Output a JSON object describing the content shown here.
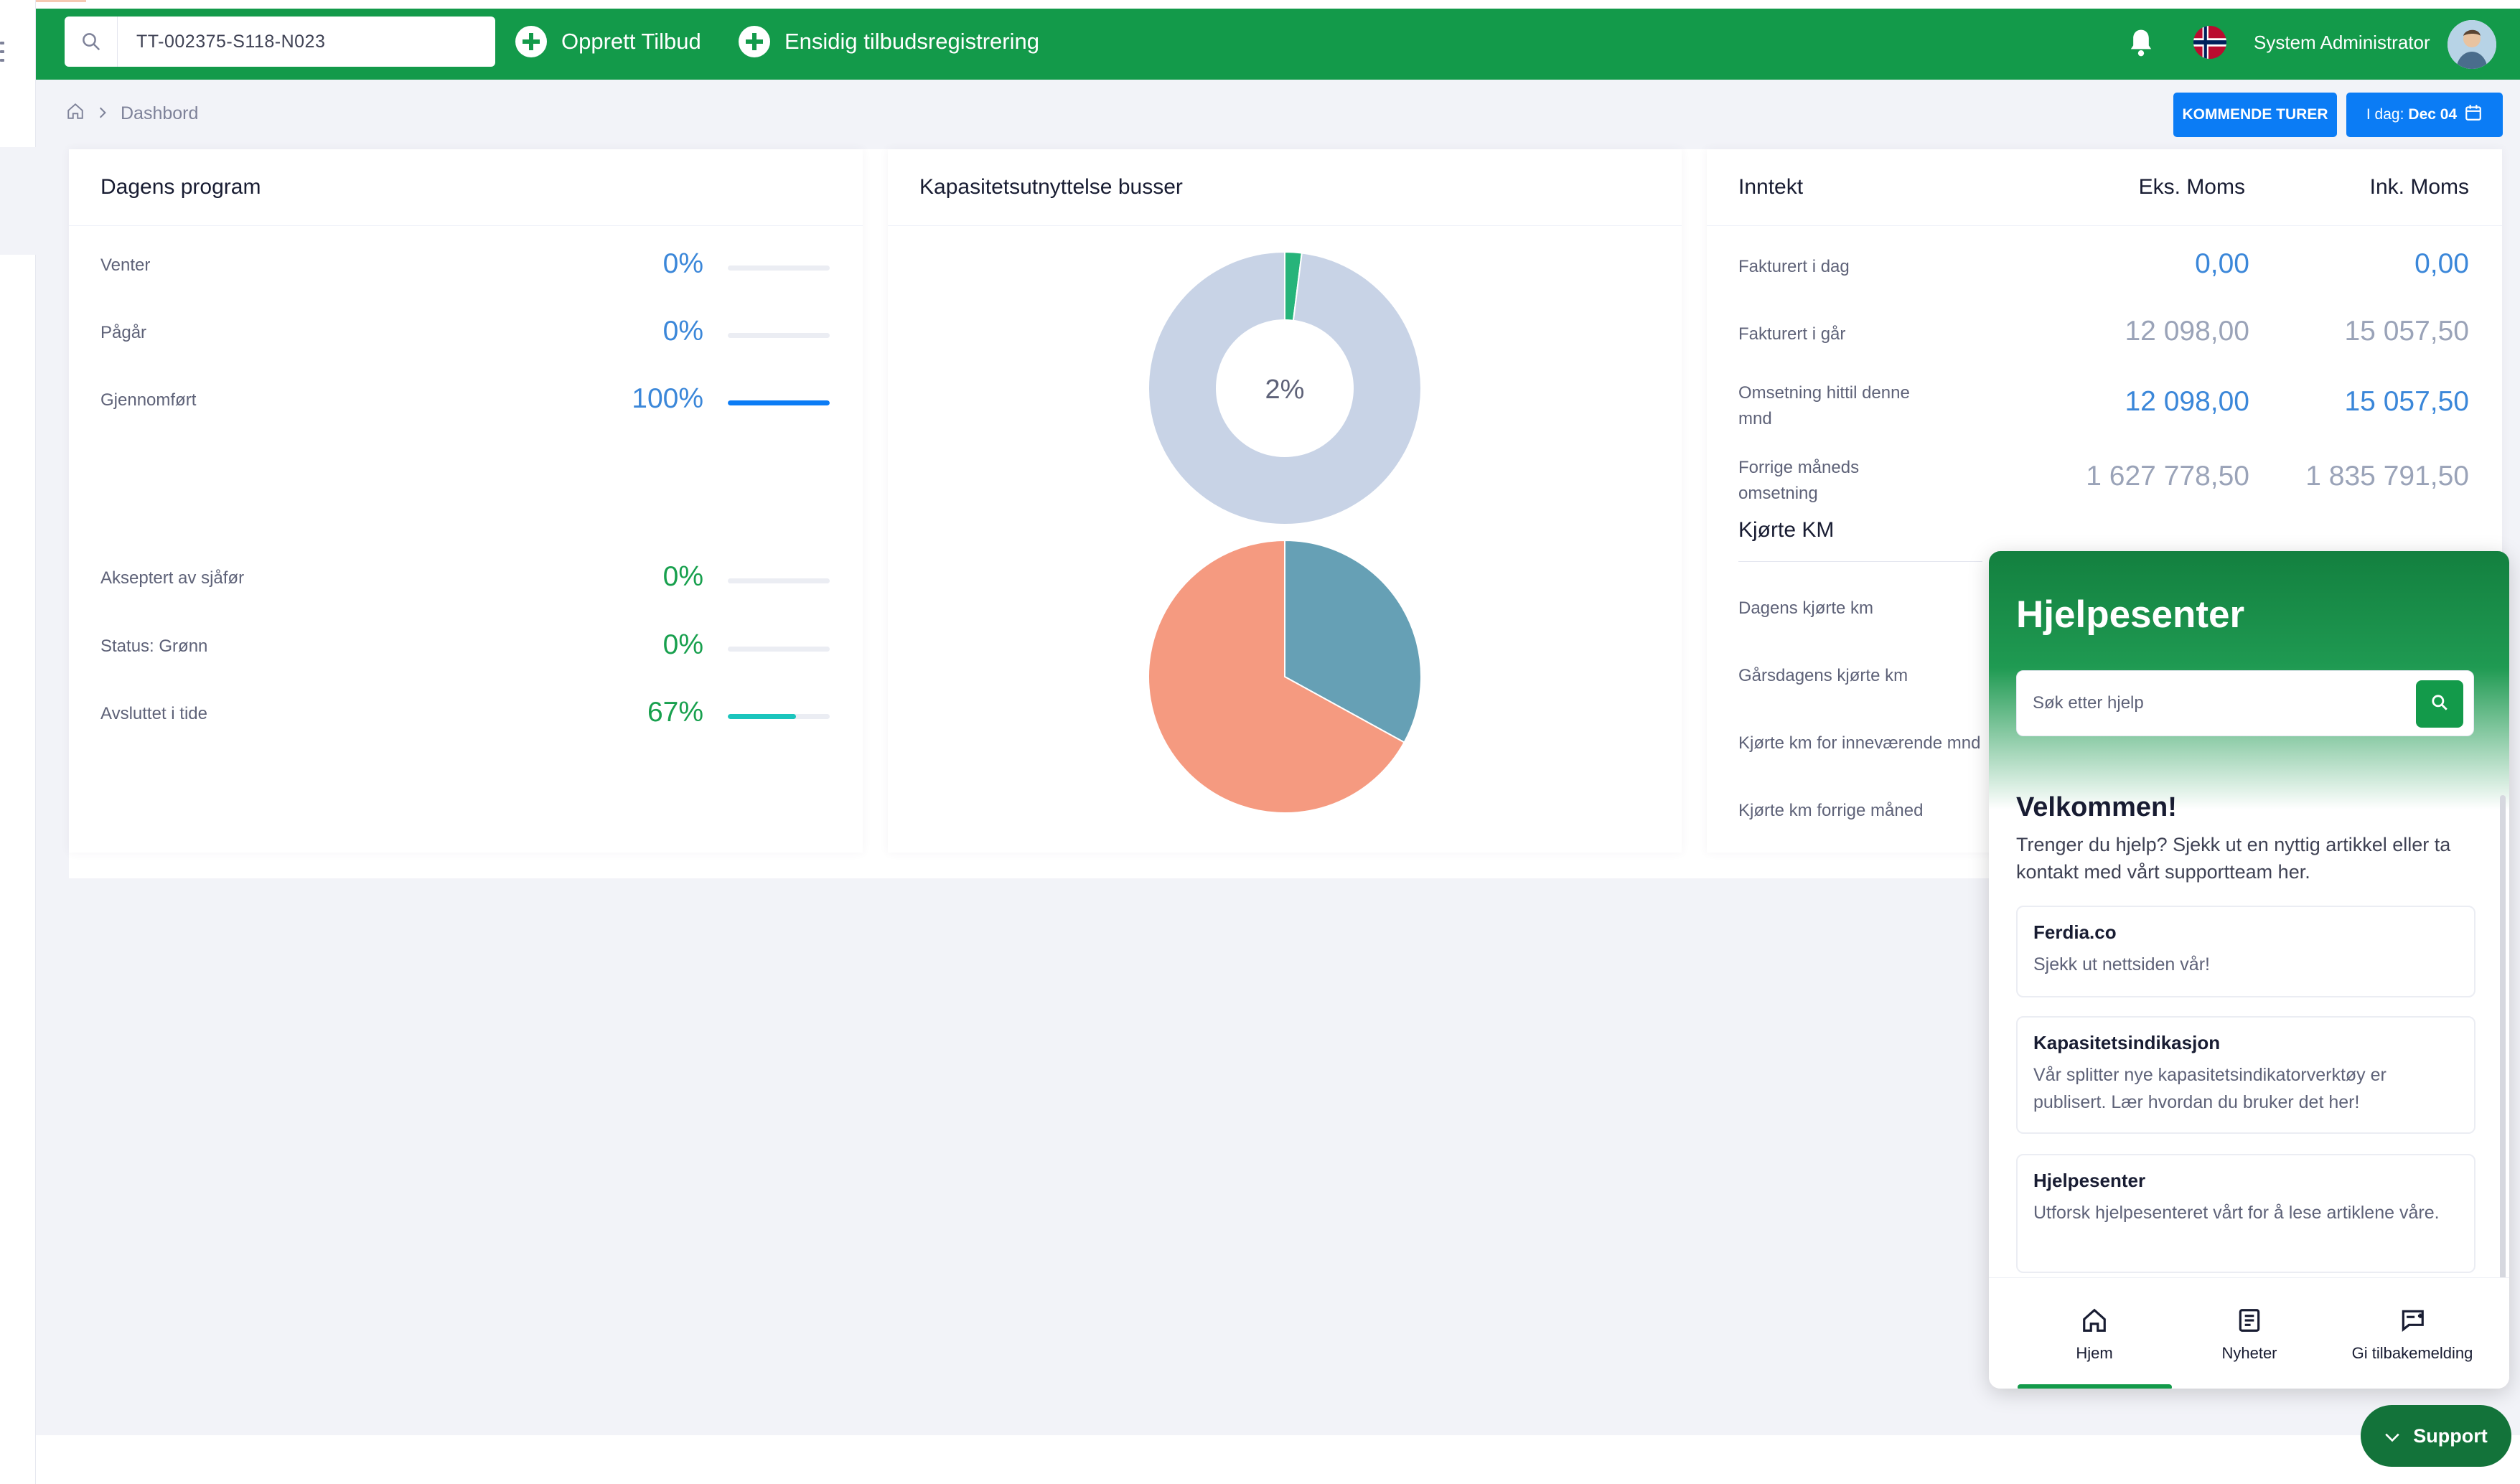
{
  "header": {
    "search_value": "TT-002375-S118-N023",
    "create_offer_label": "Opprett Tilbud",
    "one_way_label": "Ensidig tilbudsregistrering",
    "user_name": "System Administrator",
    "brand_color": "#139a4a"
  },
  "breadcrumb": {
    "home_icon": "home-icon",
    "current": "Dashbord"
  },
  "actions": {
    "upcoming_label": "KOMMENDE TURER",
    "today_prefix": "I dag:",
    "today_date": "Dec 04"
  },
  "program": {
    "title": "Dagens program",
    "rows": [
      {
        "label": "Venter",
        "pct": "0%",
        "fill": 0
      },
      {
        "label": "Pågår",
        "pct": "0%",
        "fill": 0
      },
      {
        "label": "Gjennomført",
        "pct": "100%",
        "fill": 1
      }
    ],
    "rows2": [
      {
        "label": "Akseptert av sjåfør",
        "pct": "0%",
        "fill": 0
      },
      {
        "label": "Status: Grønn",
        "pct": "0%",
        "fill": 0
      },
      {
        "label": "Avsluttet i tide",
        "pct": "67%",
        "fill": 0.67
      }
    ]
  },
  "capacity": {
    "title": "Kapasitetsutnyttelse busser"
  },
  "chart_data": [
    {
      "type": "pie",
      "donut": true,
      "center_label": "2%",
      "values": [
        2,
        98
      ],
      "colors": [
        "#26b47a",
        "#c8d3e6"
      ]
    },
    {
      "type": "pie",
      "values": [
        33,
        67
      ],
      "colors": [
        "#66a0b5",
        "#f59a80"
      ]
    }
  ],
  "income": {
    "title": "Inntekt",
    "col1": "Eks. Moms",
    "col2": "Ink. Moms",
    "rows": [
      {
        "label": "Fakturert i dag",
        "ex": "0,00",
        "inc": "0,00"
      },
      {
        "label": "Fakturert i går",
        "ex": "12 098,00",
        "inc": "15 057,50"
      },
      {
        "label": "Omsetning hittil denne mnd",
        "ex": "12 098,00",
        "inc": "15 057,50"
      },
      {
        "label": "Forrige måneds omsetning",
        "ex": "1 627 778,50",
        "inc": "1 835 791,50"
      }
    ],
    "km_title": "Kjørte KM",
    "km_rows": [
      "Dagens kjørte km",
      "Gårsdagens kjørte km",
      "Kjørte km for inneværende mnd",
      "Kjørte km forrige måned"
    ]
  },
  "help": {
    "title": "Hjelpesenter",
    "search_placeholder": "Søk etter hjelp",
    "welcome": "Velkommen!",
    "welcome_text": "Trenger du hjelp? Sjekk ut en nyttig artikkel eller ta kontakt med vårt supportteam her.",
    "cards": [
      {
        "title": "Ferdia.co",
        "desc": "Sjekk ut nettsiden vår!"
      },
      {
        "title": "Kapasitetsindikasjon",
        "desc": "Vår splitter nye kapasitetsindikatorverktøy er publisert. Lær hvordan du bruker det her!"
      },
      {
        "title": "Hjelpesenter",
        "desc": "Utforsk hjelpesenteret vårt for å lese artiklene våre."
      }
    ],
    "nav": [
      "Hjem",
      "Nyheter",
      "Gi tilbakemelding"
    ]
  },
  "support_label": "Support"
}
